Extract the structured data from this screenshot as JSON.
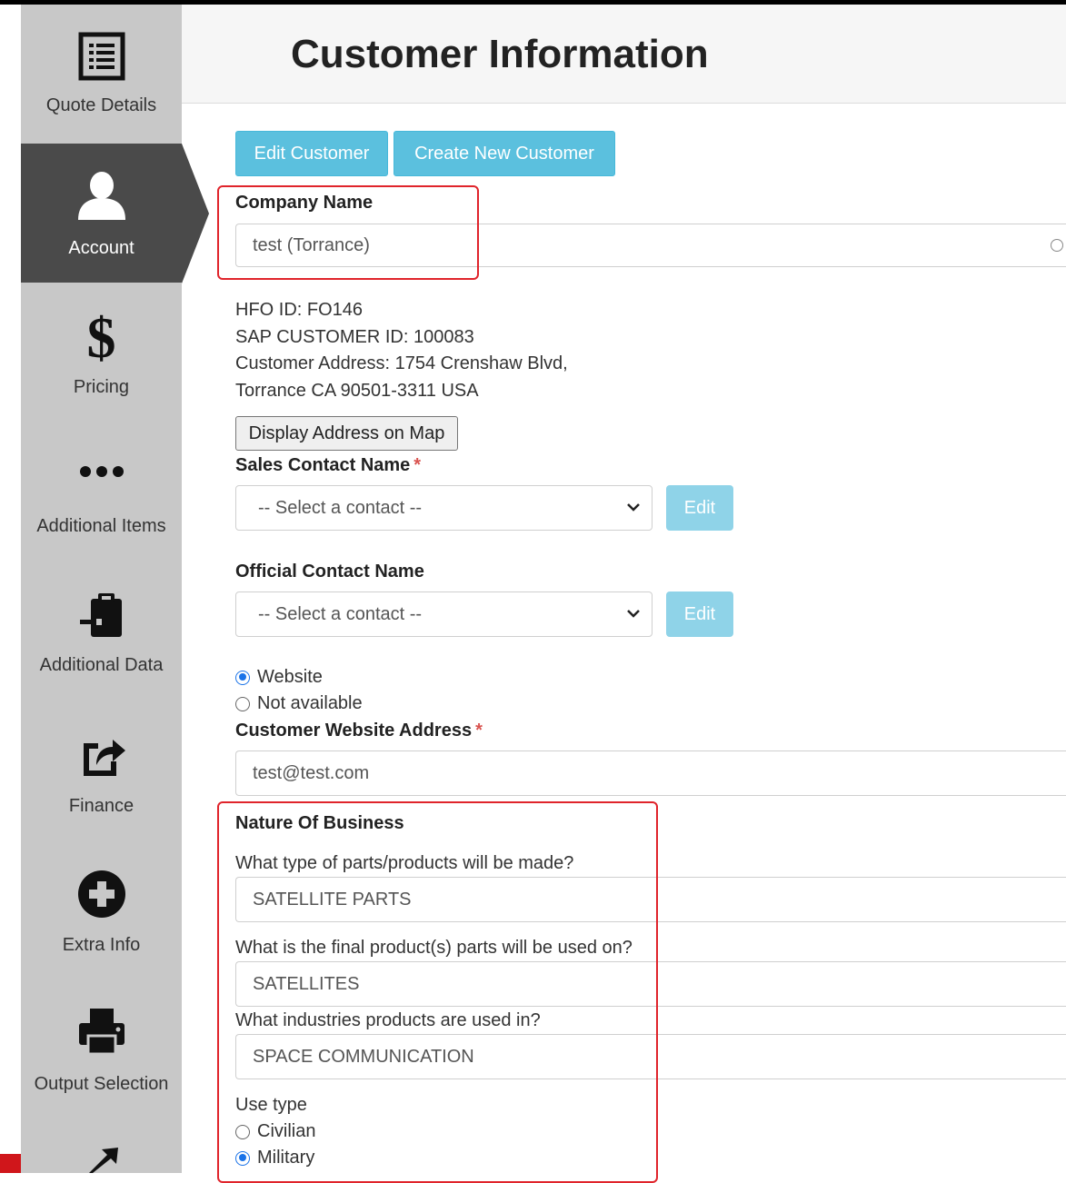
{
  "sidebar": {
    "items": [
      {
        "label": "Quote Details",
        "icon": "list-document-icon",
        "active": false
      },
      {
        "label": "Account",
        "icon": "user-icon",
        "active": true
      },
      {
        "label": "Pricing",
        "icon": "dollar-icon",
        "active": false
      },
      {
        "label": "Additional Items",
        "icon": "ellipsis-icon",
        "active": false
      },
      {
        "label": "Additional Data",
        "icon": "clipboard-import-icon",
        "active": false
      },
      {
        "label": "Finance",
        "icon": "share-icon",
        "active": false
      },
      {
        "label": "Extra Info",
        "icon": "plus-circle-icon",
        "active": false
      },
      {
        "label": "Output Selection",
        "icon": "printer-icon",
        "active": false
      }
    ]
  },
  "header": {
    "title": "Customer Information"
  },
  "toolbar": {
    "edit_customer": "Edit Customer",
    "create_customer": "Create New Customer"
  },
  "company": {
    "label": "Company Name",
    "value": "test (Torrance)"
  },
  "customer_info": {
    "hfo_id": "HFO ID: FO146",
    "sap_id": "SAP CUSTOMER ID: 100083",
    "address_line1": "Customer Address: 1754 Crenshaw Blvd,",
    "address_line2": "Torrance CA 90501-3311 USA"
  },
  "map_button": "Display Address on Map",
  "sales_contact": {
    "label": "Sales Contact Name",
    "required": "*",
    "selected": "-- Select a contact --",
    "edit_label": "Edit"
  },
  "official_contact": {
    "label": "Official Contact Name",
    "selected": "-- Select a contact --",
    "edit_label": "Edit"
  },
  "website_choice": {
    "option_website": "Website",
    "option_not_available": "Not available",
    "selected": "Website"
  },
  "website": {
    "label": "Customer Website Address",
    "required": "*",
    "value": "test@test.com"
  },
  "nature": {
    "title": "Nature Of Business",
    "q1": "What type of parts/products will be made?",
    "a1": "SATELLITE PARTS",
    "q2": "What is the final product(s) parts will be used on?",
    "a2": "SATELLITES",
    "q3": "What industries products are used in?",
    "a3": "SPACE COMMUNICATION",
    "use_type_label": "Use type",
    "option_civilian": "Civilian",
    "option_military": "Military",
    "use_type_selected": "Military"
  },
  "colors": {
    "accent": "#5bc0de",
    "sidebar_bg": "#c8c8c8",
    "active_bg": "#4a4a4a",
    "highlight": "#e0242b"
  }
}
